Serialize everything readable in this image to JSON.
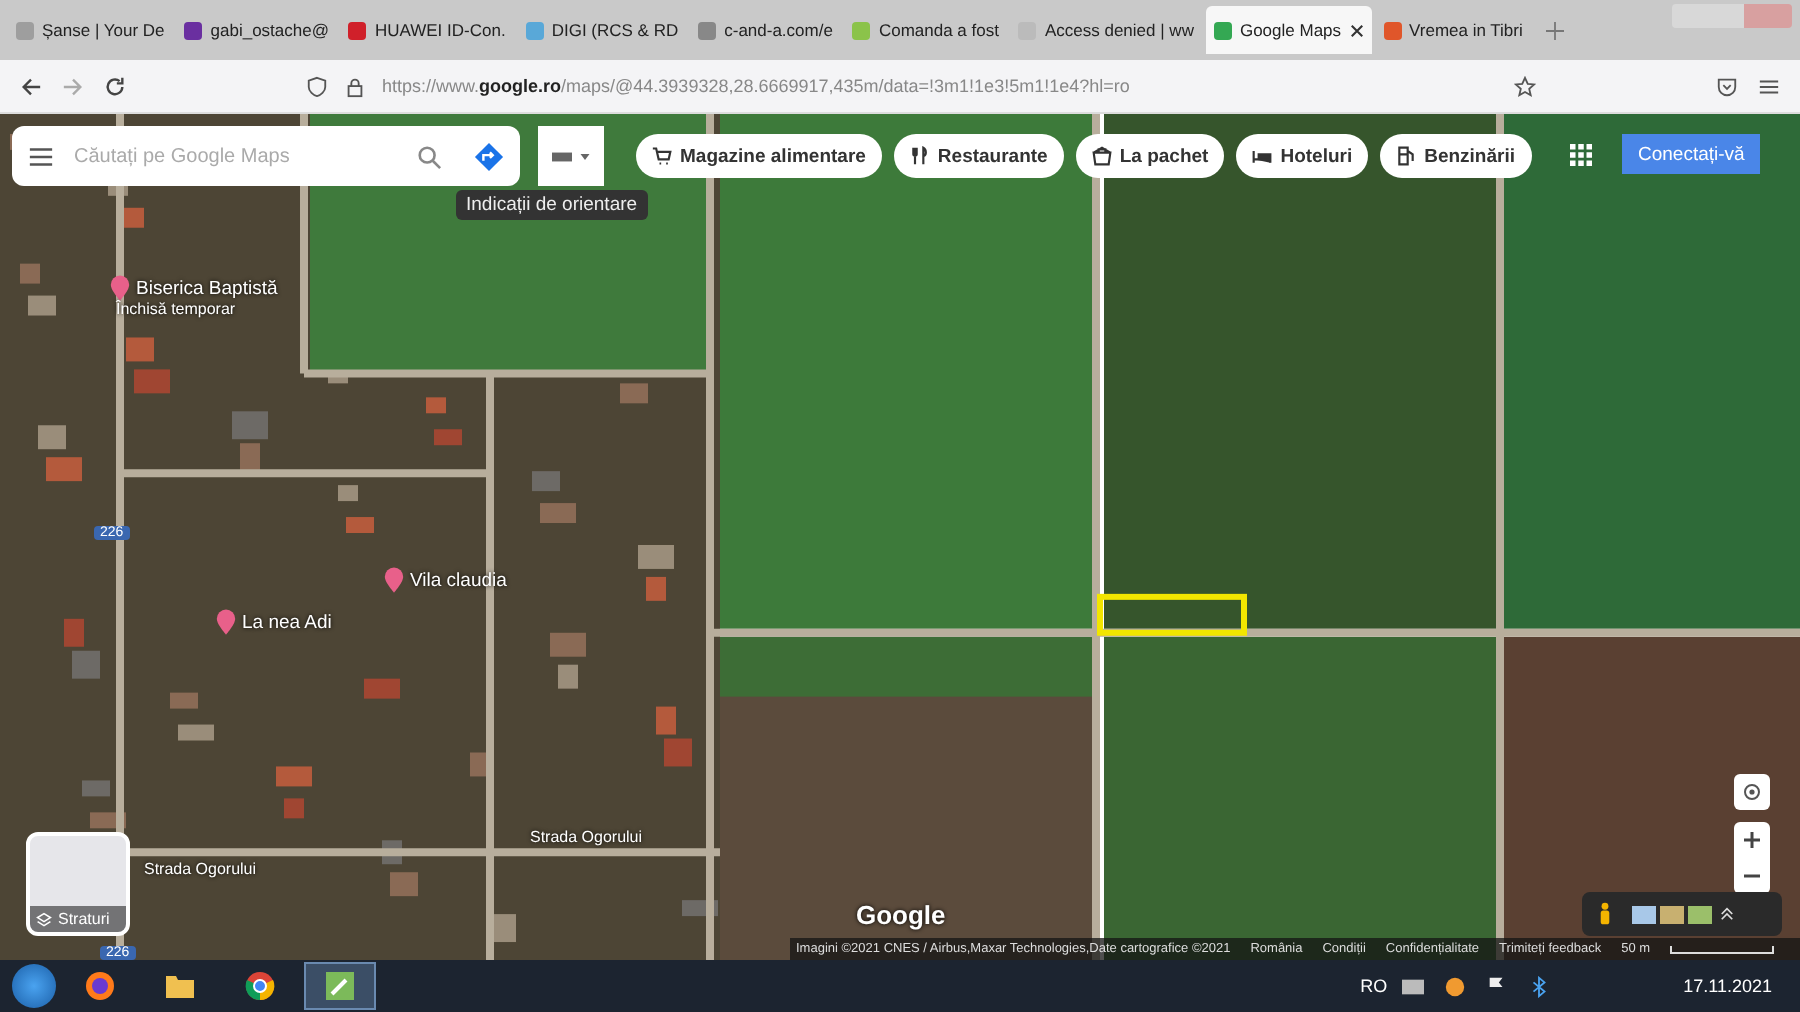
{
  "browser": {
    "tabs": [
      {
        "label": "Șanse | Your De",
        "selected": false,
        "color": "#9e9e9e"
      },
      {
        "label": "gabi_ostache@",
        "selected": false,
        "color": "#6a2fa0"
      },
      {
        "label": "HUAWEI ID-Con.",
        "selected": false,
        "color": "#d0202a"
      },
      {
        "label": "DIGI (RCS & RD",
        "selected": false,
        "color": "#59a8d8"
      },
      {
        "label": "c-and-a.com/e",
        "selected": false,
        "color": "#888888"
      },
      {
        "label": "Comanda a fost",
        "selected": false,
        "color": "#8bc34a"
      },
      {
        "label": "Access denied | ww",
        "selected": false,
        "color": "#bbbbbb"
      },
      {
        "label": "Google Maps",
        "selected": true,
        "color": "#34a853"
      },
      {
        "label": "Vremea in Tibri",
        "selected": false,
        "color": "#e0562a"
      }
    ],
    "url": "https://www.**google.ro**/maps/@44.3939328,28.6669917,435m/data=!3m1!1e3!5m1!1e4?hl=ro"
  },
  "maps": {
    "search": {
      "placeholder": "Căutați pe Google Maps"
    },
    "tooltip": "Indicații de orientare",
    "chips": [
      {
        "label": "Magazine alimentare",
        "kind": "cart"
      },
      {
        "label": "Restaurante",
        "kind": "fork"
      },
      {
        "label": "La pachet",
        "kind": "bag"
      },
      {
        "label": "Hoteluri",
        "kind": "bed"
      },
      {
        "label": "Benzinării",
        "kind": "fuel"
      }
    ],
    "sign_in": "Conectați-vă",
    "labels": [
      {
        "text": "Biserica Baptistă",
        "kind": "place"
      },
      {
        "text": "Închisă temporar",
        "kind": "note"
      },
      {
        "text": "La nea Adi",
        "kind": "place"
      },
      {
        "text": "Vila claudia",
        "kind": "place"
      },
      {
        "text": "Strada Ogorului",
        "kind": "street"
      },
      {
        "text": "Strada Ogorului",
        "kind": "street"
      },
      {
        "text": "226",
        "kind": "shield"
      },
      {
        "text": "226",
        "kind": "shield"
      }
    ],
    "layers": "Straturi",
    "logo": "Google",
    "footer": [
      "Imagini ©2021 CNES / Airbus,Maxar Technologies,Date cartografice ©2021",
      "România",
      "Condiții",
      "Confidențialitate",
      "Trimiteți feedback"
    ],
    "scale": "50 m"
  },
  "taskbar": {
    "apps": [
      {
        "kind": "firefox",
        "selected": false
      },
      {
        "kind": "folder",
        "selected": false
      },
      {
        "kind": "chrome",
        "selected": false
      },
      {
        "kind": "tool",
        "selected": true
      }
    ],
    "language": "RO",
    "date": "17.11.2021"
  }
}
